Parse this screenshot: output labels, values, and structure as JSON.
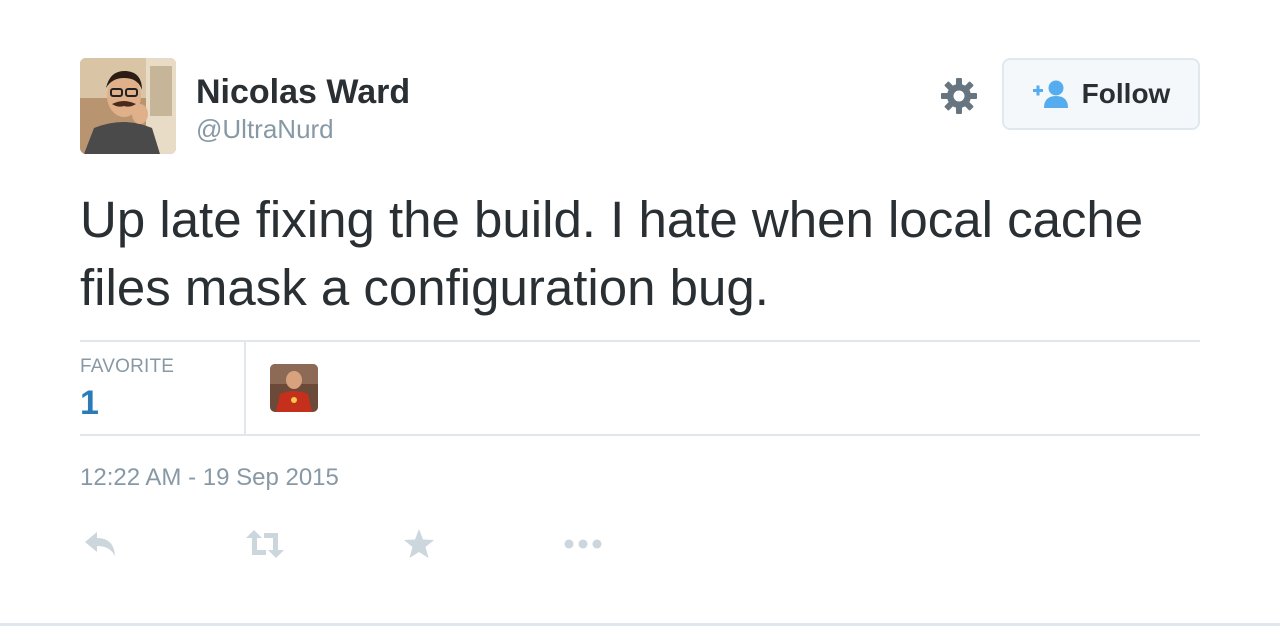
{
  "author": {
    "name": "Nicolas Ward",
    "handle": "@UltraNurd"
  },
  "follow_button": {
    "label": "Follow",
    "icon": "add-user-icon"
  },
  "settings_icon": "gear-icon",
  "tweet": {
    "text": "Up late fixing the build. I hate when local cache files mask a configuration bug."
  },
  "stats": {
    "favorite_label": "FAVORITE",
    "favorite_count": "1"
  },
  "timestamp": "12:22 AM - 19 Sep 2015",
  "actions": [
    "reply-icon",
    "retweet-icon",
    "favorite-star-icon",
    "more-dots-icon"
  ],
  "colors": {
    "link_blue": "#2b7bb9",
    "follow_icon_blue": "#55acee",
    "muted_gray": "#8899a6",
    "action_gray": "#ccd6dd",
    "divider": "#e1e8ed",
    "text": "#292f33"
  }
}
